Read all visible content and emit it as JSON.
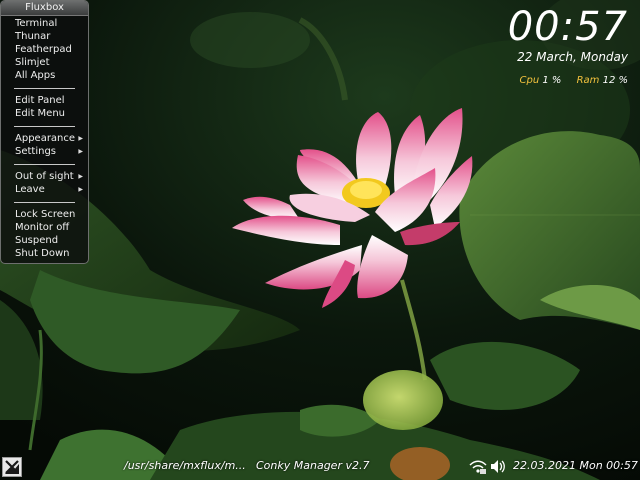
{
  "menu": {
    "title": "Fluxbox",
    "groups": [
      [
        "Terminal",
        "Thunar",
        "Featherpad",
        "Slimjet",
        "All Apps"
      ],
      [
        "Edit Panel",
        "Edit Menu"
      ],
      [
        "Appearance",
        "Settings"
      ],
      [
        "Out of sight",
        "Leave"
      ],
      [
        "Lock Screen",
        "Monitor off",
        "Suspend",
        "Shut Down"
      ]
    ]
  },
  "conky": {
    "time": "00:57",
    "date": "22 March, Monday",
    "cpu_label": "Cpu",
    "cpu_value": "1 %",
    "ram_label": "Ram",
    "ram_value": "12 %"
  },
  "taskbar": {
    "tasks": [
      "/usr/share/mxflux/m...",
      "Conky Manager v2.7"
    ],
    "clock": "22.03.2021 Mon 00:57"
  },
  "colors": {
    "stat_label": "#f2c13d",
    "menu_bg": "#0c0e0e"
  }
}
